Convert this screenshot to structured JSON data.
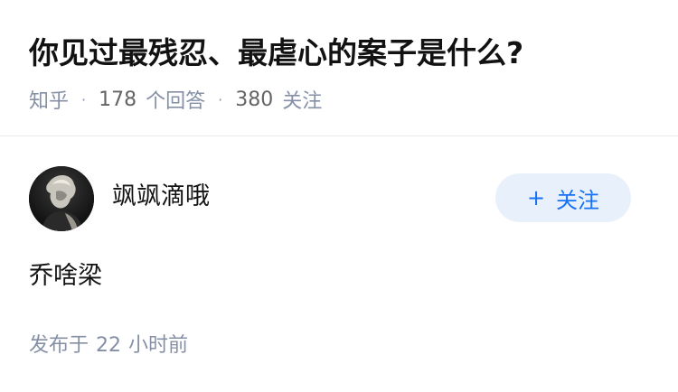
{
  "question": {
    "title": "你见过最残忍、最虐心的案子是什么?",
    "source": "知乎",
    "answer_count": "178",
    "answer_label": "个回答",
    "follower_count": "380",
    "follower_label": "关注"
  },
  "answer": {
    "author_name": "飒飒滴哦",
    "follow_button": {
      "icon": "plus-icon",
      "plus": "+",
      "label": "关注"
    },
    "content": "乔啥梁",
    "publish": {
      "prefix": "发布于",
      "number": "22",
      "suffix": "小时前"
    }
  },
  "colors": {
    "title": "#121212",
    "meta": "#8590a6",
    "accent": "#1772f6",
    "follow_bg": "#e8f0fb"
  }
}
